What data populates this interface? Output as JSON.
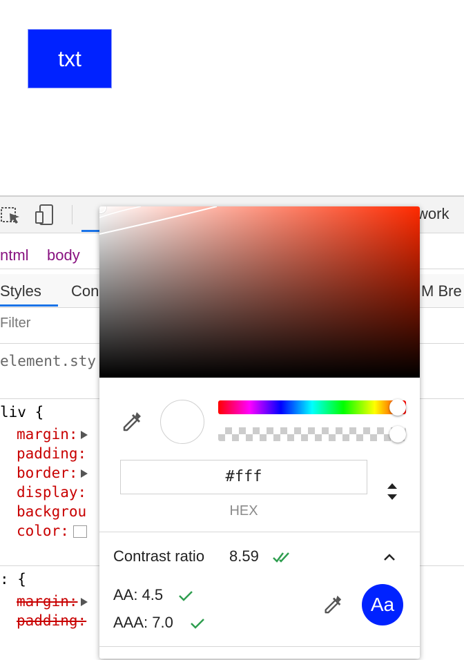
{
  "demo": {
    "text": "txt",
    "background": "#0022ff"
  },
  "devtools": {
    "tabs": {
      "network_partial": "work"
    },
    "breadcrumbs": [
      "ntml",
      "body"
    ],
    "subtabs": [
      "Styles",
      "Con",
      "M Bre"
    ],
    "filter_placeholder": "Filter",
    "rules": {
      "element_style": "element.sty",
      "div_selector": "liv {",
      "div_props": [
        "margin:",
        "padding:",
        "border:",
        "display:",
        "backgrou",
        "color:"
      ],
      "star_selector": ": {",
      "star_props": [
        "margin:",
        "padding:"
      ]
    }
  },
  "picker": {
    "hex_value": "#fff",
    "format_label": "HEX",
    "contrast": {
      "title": "Contrast ratio",
      "value": "8.59"
    },
    "aa": "AA: 4.5",
    "aaa": "AAA: 7.0",
    "swatch_text": "Aa",
    "colors": {
      "hue": "#ff2a00",
      "swatch_bg": "#0022ff",
      "check_green": "#2e9e4f"
    }
  }
}
